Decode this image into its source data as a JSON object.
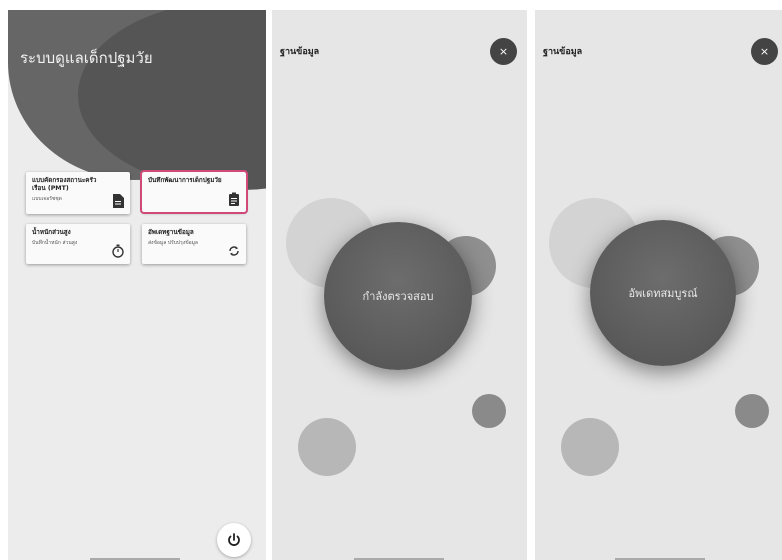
{
  "screen1": {
    "title": "ระบบดูแลเด็กปฐมวัย",
    "cards": [
      {
        "title": "แบบคัดกรองสถานะครัวเรือน (PMT)",
        "subtitle": "แบบเจอรัชชุด",
        "icon": "document-icon",
        "selected": false
      },
      {
        "title": "บันทึกพัฒนาการเด็กปฐมวัย",
        "subtitle": "",
        "icon": "clipboard-icon",
        "selected": true
      },
      {
        "title": "น้ำหนักส่วนสูง",
        "subtitle": "บันทึกน้ำหนัก ส่วนสูง",
        "icon": "stopwatch-icon",
        "selected": false
      },
      {
        "title": "อัพเดทฐานข้อมูล",
        "subtitle": "ส่งข้อมูล ปรับปรุงข้อมูล",
        "icon": "sync-icon",
        "selected": false
      }
    ],
    "power_icon": "power-icon",
    "accent": "#d04a79"
  },
  "screen2": {
    "header": "ฐานข้อมูล",
    "close_label": "×",
    "status": "กำลังตรวจสอบ"
  },
  "screen3": {
    "header": "ฐานข้อมูล",
    "close_label": "×",
    "status": "อัพเดทสมบูรณ์"
  }
}
